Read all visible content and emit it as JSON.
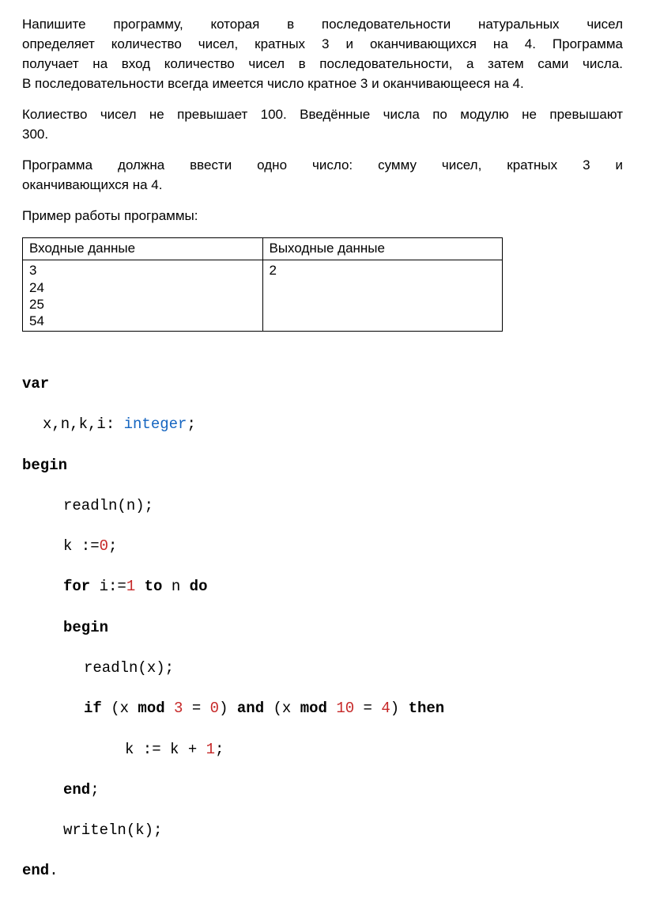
{
  "problem": {
    "p1a": "Напишите программу, которая в последовательности натуральных чисел",
    "p1b": "определяет количество чисел, кратных 3 и оканчивающихся на 4. Программа",
    "p1c": "получает на вход количество чисел в последовательности, а затем сами числа.",
    "p1d": "В последовательности всегда имеется число кратное 3 и оканчивающееся на 4.",
    "p2a": "Колиество чисел не превышает 100. Введённые числа по модулю не превышают",
    "p2b": "300.",
    "p3a": "Программа должна ввести одно число: сумму чисел, кратных 3 и",
    "p3b": "оканчивающихся на 4.",
    "p4": "Пример работы программы:"
  },
  "table": {
    "header_in": "Входные данные",
    "header_out": "Выходные данные",
    "input": "3\n24\n25\n54",
    "output": "2"
  },
  "code": {
    "var": "var",
    "decl_pre": "x,n,k,i: ",
    "decl_type": "integer",
    "decl_post": ";",
    "begin": "begin",
    "readln_n": "readln(n);",
    "k_assign_pre": "k :=",
    "k_assign_num": "0",
    "k_assign_post": ";",
    "for_kw": "for",
    "for_i": " i:=",
    "for_num": "1",
    "for_to": " to",
    "for_n": " n ",
    "for_do": "do",
    "begin2": "begin",
    "readln_x": "readln(x);",
    "if_kw": "if",
    "if_p1": " (x ",
    "mod1": "mod",
    "if_sp1": " ",
    "num3": "3",
    "if_eq1": " = ",
    "num0": "0",
    "if_p2": ") ",
    "and_kw": "and",
    "if_p3": " (x ",
    "mod2": "mod",
    "if_sp2": " ",
    "num10": "10",
    "if_eq2": " = ",
    "num4": "4",
    "if_p4": ") ",
    "then_kw": "then",
    "k_inc_pre": "k := k + ",
    "k_inc_num": "1",
    "k_inc_post": ";",
    "end_inner": "end",
    "end_semi": ";",
    "writeln": "writeln(k);",
    "end_outer": "end",
    "end_dot": "."
  }
}
